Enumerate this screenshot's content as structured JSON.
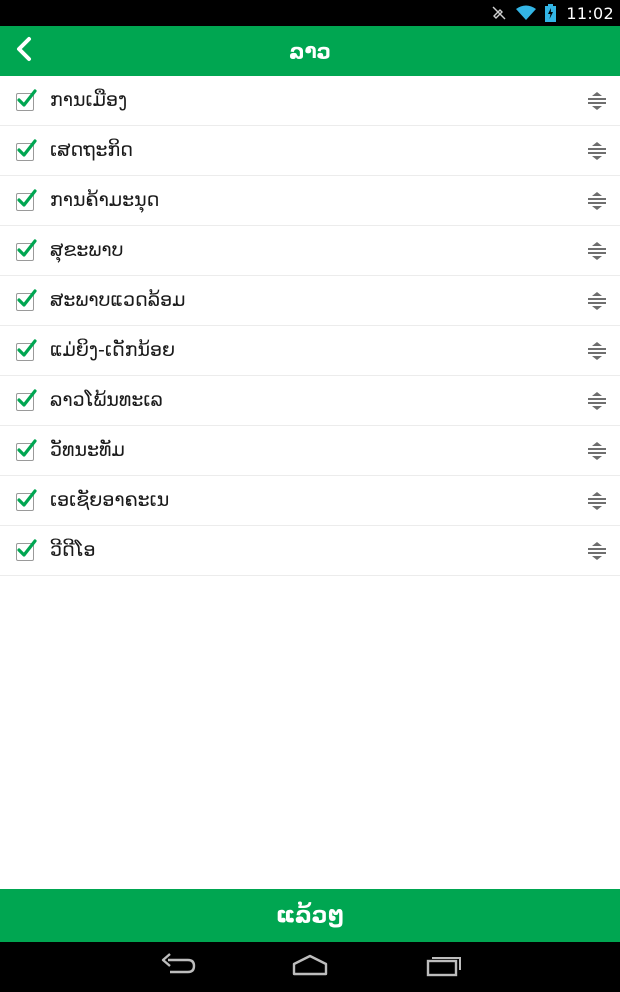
{
  "status_bar": {
    "time": "11:02",
    "icons": [
      "mute-icon",
      "wifi-icon",
      "battery-charging-icon"
    ]
  },
  "app_bar": {
    "title": "ລາວ",
    "back_icon": "chevron-left-icon"
  },
  "categories": [
    {
      "label": "ການເມືອງ",
      "checked": true
    },
    {
      "label": "ເສດຖະກິດ",
      "checked": true
    },
    {
      "label": "ການຄ້າມະນຸດ",
      "checked": true
    },
    {
      "label": "ສຸຂະພາບ",
      "checked": true
    },
    {
      "label": "ສະພາບແວດລ້ອມ",
      "checked": true
    },
    {
      "label": "ແມ່ຍິງ-ເດັກນ້ອຍ",
      "checked": true
    },
    {
      "label": "ລາວໂພ້ນທະເລ",
      "checked": true
    },
    {
      "label": "ວັທນະທັມ",
      "checked": true
    },
    {
      "label": "ເອເຊັຍອາຄະເນ",
      "checked": true
    },
    {
      "label": "ວີດີໂອ",
      "checked": true
    }
  ],
  "done_button": {
    "label": "ແລ້ວໆ"
  },
  "colors": {
    "accent": "#00a651",
    "check": "#00a651",
    "status_bar": "#000000",
    "nav_bar": "#000000"
  },
  "nav_bar": {
    "icons": [
      "back-icon",
      "home-icon",
      "recents-icon"
    ]
  }
}
